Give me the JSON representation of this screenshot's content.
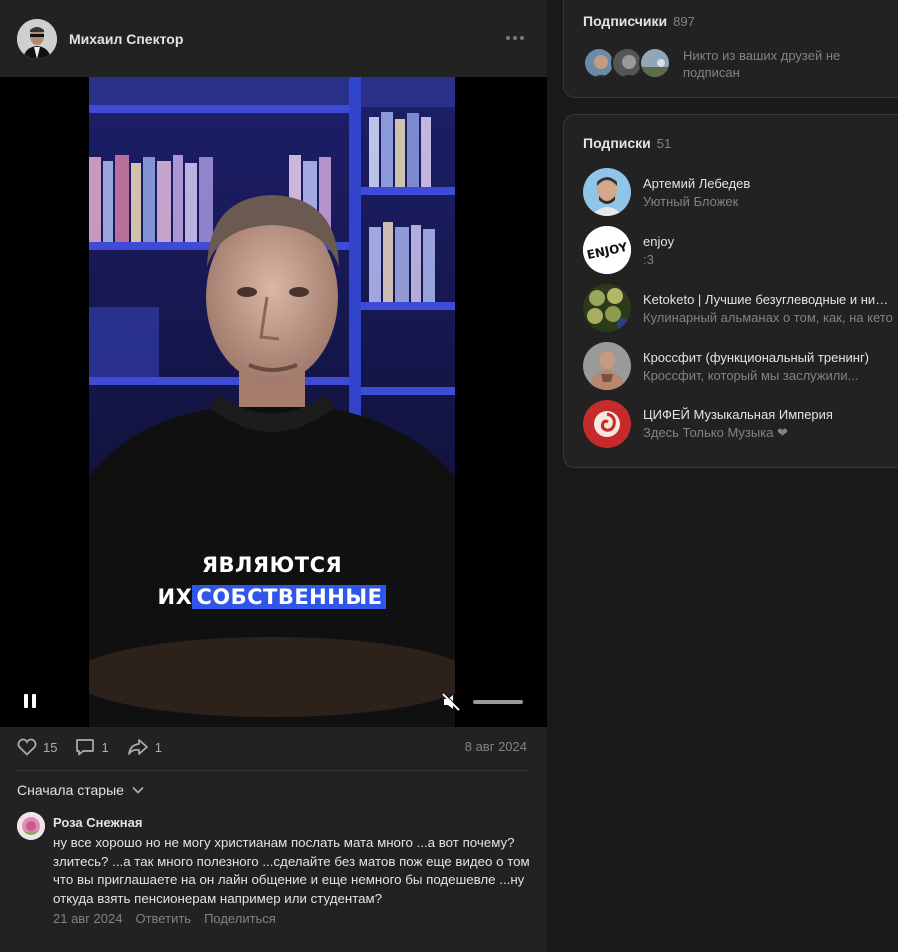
{
  "post": {
    "author": "Михаил Спектор",
    "video": {
      "caption_line1": "ЯВЛЯЮТСЯ",
      "caption_line2_plain": "ИХ",
      "caption_line2_highlight": "СОБСТВЕННЫЕ"
    },
    "likes": "15",
    "comments_count": "1",
    "shares": "1",
    "date": "8 авг 2024",
    "sort_label": "Сначала старые"
  },
  "comment": {
    "author": "Роза Снежная",
    "text": "ну все хорошо но не могу христианам послать мата много ...а вот почему? злитесь? ...а так много полезного ...сделайте без матов пож еще видео о том что вы приглашаете на он лайн общение и еще немного бы подешевле ...ну откуда взять пенсионерам например или студентам?",
    "date": "21 авг 2024",
    "reply_label": "Ответить",
    "share_label": "Поделиться"
  },
  "followers": {
    "title": "Подписчики",
    "count": "897",
    "note": "Никто из ваших друзей не подписан"
  },
  "subscriptions": {
    "title": "Подписки",
    "count": "51",
    "items": [
      {
        "name": "Артемий Лебедев",
        "desc": "Уютный Бложек"
      },
      {
        "name": "enjoy",
        "desc": ":3",
        "logo_text": "ENJOY"
      },
      {
        "name": "Ketoketo | Лучшие безуглеводные и низкоуглеводные",
        "desc": "Кулинарный альманах о том, как, на кето"
      },
      {
        "name": "Кроссфит (функциональный тренинг)",
        "desc": "Кроссфит, который мы заслужили..."
      },
      {
        "name": "ЦИФЕЙ Музыкальная Империя",
        "desc": "Здесь Только Музыка ❤"
      }
    ]
  },
  "colors": {
    "background": "#19191a",
    "card": "#222222",
    "text": "#e1e3e6",
    "secondary": "#828282",
    "caption_highlight": "#2f56e8"
  }
}
